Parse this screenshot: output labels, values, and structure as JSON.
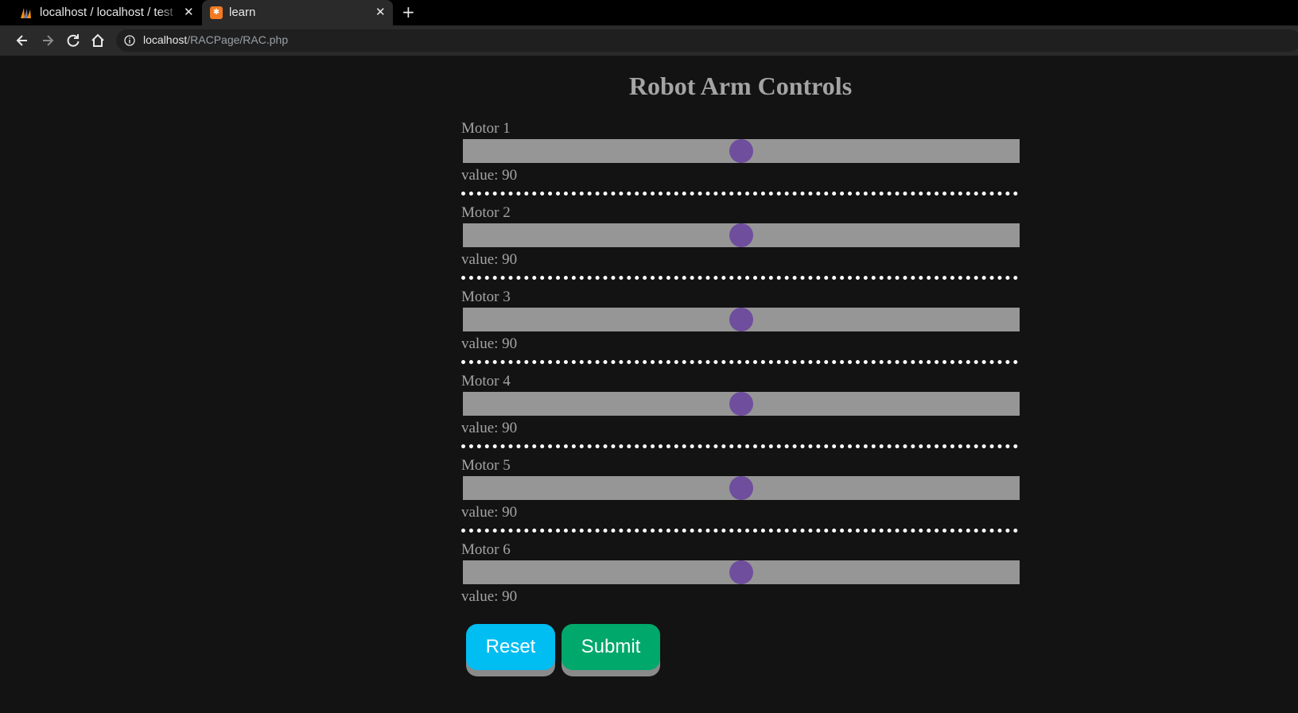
{
  "browser": {
    "tabs": [
      {
        "title": "localhost / localhost / test",
        "active": false
      },
      {
        "title": "learn",
        "active": true
      }
    ],
    "new_tab_label": "+",
    "close_label": "✕",
    "url_host": "localhost",
    "url_path": "/RACPage/RAC.php"
  },
  "page": {
    "title": "Robot Arm Controls",
    "motors": [
      {
        "label": "Motor 1",
        "value_text": "value: 90",
        "value": 90,
        "max": 180
      },
      {
        "label": "Motor 2",
        "value_text": "value: 90",
        "value": 90,
        "max": 180
      },
      {
        "label": "Motor 3",
        "value_text": "value: 90",
        "value": 90,
        "max": 180
      },
      {
        "label": "Motor 4",
        "value_text": "value: 90",
        "value": 90,
        "max": 180
      },
      {
        "label": "Motor 5",
        "value_text": "value: 90",
        "value": 90,
        "max": 180
      },
      {
        "label": "Motor 6",
        "value_text": "value: 90",
        "value": 90,
        "max": 180
      }
    ],
    "buttons": {
      "reset_label": "Reset",
      "submit_label": "Submit"
    },
    "colors": {
      "background": "#131313",
      "slider_track": "#969696",
      "slider_thumb": "#6f4e9d",
      "reset_button": "#00bdf2",
      "submit_button": "#00a86b",
      "text": "#a4a4a4"
    }
  }
}
